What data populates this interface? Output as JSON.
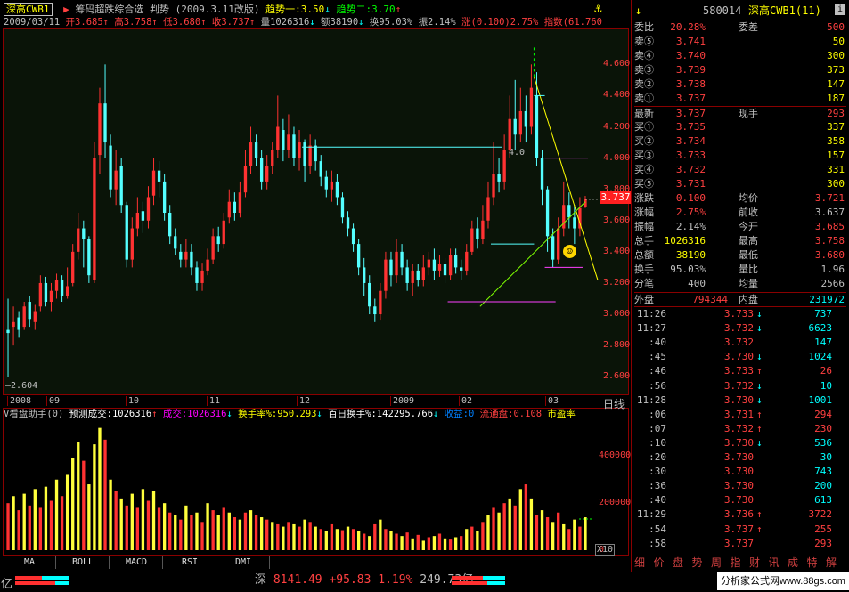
{
  "header": {
    "code_name": "深高CWB1",
    "indicator_name": "筹码超跌综合选",
    "mode": "判势",
    "date_tag": "(2009.3.11改版)",
    "trend1": "趋势一:3.50",
    "trend1_arrow": "↓",
    "trend2": "趋势二:3.70",
    "trend2_arrow": "↑",
    "icon_gear": "gear-icon",
    "row2": {
      "date": "2009/03/11",
      "open": "开3.685",
      "open_arrow": "↑",
      "high": "高3.758",
      "high_arrow": "↑",
      "low": "低3.680",
      "low_arrow": "↑",
      "close": "收3.737",
      "close_arrow": "↑",
      "volume": "量1026316",
      "volume_arrow": "↓",
      "amount": "额38190",
      "amount_arrow": "↓",
      "turnover": "换95.03%",
      "amplitude": "振2.14%",
      "change": "涨(0.100)2.75%",
      "index": "指数(61.760"
    }
  },
  "price_axis": {
    "ticks": [
      "4.600",
      "4.400",
      "4.200",
      "4.000",
      "3.800",
      "3.600",
      "3.400",
      "3.200",
      "3.000",
      "2.800",
      "2.600"
    ],
    "current_price_label": "3.737",
    "low_marker": "2.604",
    "inline_label_4": "4.0"
  },
  "time_axis": {
    "labels": [
      "2008",
      "09",
      "10",
      "11",
      "12",
      "2009",
      "02",
      "03"
    ],
    "period": "日线"
  },
  "volume_header": {
    "name": "V看盘助手(0)",
    "predicted": "预测成交:1026316",
    "predicted_arrow": "↑",
    "deal": "成交:1026316",
    "deal_arrow": "↓",
    "turnover_rate": "换手率%:950.293",
    "turnover_arrow": "↓",
    "hundred_day": "百日换手%:142295.766",
    "hundred_arrow": "↓",
    "earnings": "收益:0",
    "float_cap": "流通盘:0.108",
    "pe": "市盈率"
  },
  "volume_axis": {
    "ticks": [
      "400000",
      "200000",
      "0"
    ],
    "multiplier": "X10"
  },
  "bottom_tabs": [
    "MA",
    "BOLL",
    "MACD",
    "RSI",
    "DMI"
  ],
  "right_tabs": [
    "细",
    "价",
    "盘",
    "势",
    "周",
    "指",
    "财",
    "讯",
    "成",
    "特",
    "解"
  ],
  "ticker_bar": {
    "exchange": "深",
    "index_value": "8141.49",
    "change": "+95.83",
    "percent": "1.19%",
    "amount": "249.73亿",
    "left_unit": "亿",
    "watermark": "分析家公式网www.88gs.com"
  },
  "quote_panel": {
    "code": "580014",
    "name": "深高CWB1(11)",
    "commission_ratio_label": "委比",
    "commission_ratio": "20.28%",
    "commission_diff_label": "委差",
    "commission_diff": "500",
    "asks": [
      {
        "label": "卖⑤",
        "price": "3.741",
        "vol": "50"
      },
      {
        "label": "卖④",
        "price": "3.740",
        "vol": "300"
      },
      {
        "label": "卖③",
        "price": "3.739",
        "vol": "373"
      },
      {
        "label": "卖②",
        "price": "3.738",
        "vol": "147"
      },
      {
        "label": "卖①",
        "price": "3.737",
        "vol": "187"
      }
    ],
    "last_label": "最新",
    "last": "3.737",
    "hand_label": "现手",
    "hand": "293",
    "bids": [
      {
        "label": "买①",
        "price": "3.735",
        "vol": "337"
      },
      {
        "label": "买②",
        "price": "3.734",
        "vol": "358"
      },
      {
        "label": "买③",
        "price": "3.733",
        "vol": "157"
      },
      {
        "label": "买④",
        "price": "3.732",
        "vol": "331"
      },
      {
        "label": "买⑤",
        "price": "3.731",
        "vol": "300"
      }
    ],
    "stats": [
      {
        "l1": "涨跌",
        "v1": "0.100",
        "l2": "均价",
        "v2": "3.721",
        "c1": "#ff4040",
        "c2": "#ff4040"
      },
      {
        "l1": "涨幅",
        "v1": "2.75%",
        "l2": "前收",
        "v2": "3.637",
        "c1": "#ff4040",
        "c2": "#c0c0c0"
      },
      {
        "l1": "振幅",
        "v1": "2.14%",
        "l2": "今开",
        "v2": "3.685",
        "c1": "#c0c0c0",
        "c2": "#ff4040"
      },
      {
        "l1": "总手",
        "v1": "1026316",
        "l2": "最高",
        "v2": "3.758",
        "c1": "#ffff00",
        "c2": "#ff4040"
      },
      {
        "l1": "总额",
        "v1": "38190",
        "l2": "最低",
        "v2": "3.680",
        "c1": "#ffff00",
        "c2": "#ff4040"
      },
      {
        "l1": "换手",
        "v1": "95.03%",
        "l2": "量比",
        "v2": "1.96",
        "c1": "#c0c0c0",
        "c2": "#c0c0c0"
      },
      {
        "l1": "分笔",
        "v1": "400",
        "l2": "均量",
        "v2": "2566",
        "c1": "#c0c0c0",
        "c2": "#c0c0c0"
      }
    ],
    "outer_label": "外盘",
    "outer": "794344",
    "inner_label": "内盘",
    "inner": "231972",
    "trades": [
      {
        "t": "11:26",
        "p": "3.733",
        "a": "↓",
        "q": "737",
        "k": "",
        "c": "#ff4040",
        "ac": "#00ffff"
      },
      {
        "t": "11:27",
        "p": "3.732",
        "a": "↓",
        "q": "6623",
        "k": "",
        "c": "#ff4040",
        "ac": "#00ffff"
      },
      {
        "t": ":40",
        "p": "3.732",
        "a": "",
        "q": "147",
        "k": "",
        "c": "#ff4040",
        "ac": "#00ffff"
      },
      {
        "t": ":45",
        "p": "3.730",
        "a": "↓",
        "q": "1024",
        "k": "",
        "c": "#ff4040",
        "ac": "#00ffff"
      },
      {
        "t": ":46",
        "p": "3.733",
        "a": "↑",
        "q": "26",
        "k": "",
        "c": "#ff4040",
        "ac": "#ff4040"
      },
      {
        "t": ":56",
        "p": "3.732",
        "a": "↓",
        "q": "10",
        "k": "",
        "c": "#ff4040",
        "ac": "#00ffff"
      },
      {
        "t": "11:28",
        "p": "3.730",
        "a": "↓",
        "q": "1001",
        "k": "",
        "c": "#ff4040",
        "ac": "#00ffff"
      },
      {
        "t": ":06",
        "p": "3.731",
        "a": "↑",
        "q": "294",
        "k": "",
        "c": "#ff4040",
        "ac": "#ff4040"
      },
      {
        "t": ":07",
        "p": "3.732",
        "a": "↑",
        "q": "230",
        "k": "",
        "c": "#ff4040",
        "ac": "#ff4040"
      },
      {
        "t": ":10",
        "p": "3.730",
        "a": "↓",
        "q": "536",
        "k": "",
        "c": "#ff4040",
        "ac": "#00ffff"
      },
      {
        "t": ":20",
        "p": "3.730",
        "a": "",
        "q": "30",
        "k": "",
        "c": "#ff4040",
        "ac": "#00ffff"
      },
      {
        "t": ":30",
        "p": "3.730",
        "a": "",
        "q": "743",
        "k": "",
        "c": "#ff4040",
        "ac": "#00ffff"
      },
      {
        "t": ":36",
        "p": "3.730",
        "a": "",
        "q": "200",
        "k": "",
        "c": "#ff4040",
        "ac": "#00ffff"
      },
      {
        "t": ":40",
        "p": "3.730",
        "a": "",
        "q": "613",
        "k": "",
        "c": "#ff4040",
        "ac": "#00ffff"
      },
      {
        "t": "11:29",
        "p": "3.736",
        "a": "↑",
        "q": "3722",
        "k": "",
        "c": "#ff4040",
        "ac": "#ff4040"
      },
      {
        "t": ":54",
        "p": "3.737",
        "a": "↑",
        "q": "255",
        "k": "",
        "c": "#ff4040",
        "ac": "#ff4040"
      },
      {
        "t": ":58",
        "p": "3.737",
        "a": "",
        "q": "293",
        "k": "",
        "c": "#ff4040",
        "ac": "#ff4040"
      }
    ]
  },
  "colors": {
    "up": "#ff3232",
    "down": "#54ffff",
    "vol_up": "#ff3232",
    "vol_alt": "#ffff3c",
    "axis": "#ff4040",
    "pane_border": "#8a0000"
  },
  "chart_data": {
    "type": "candlestick",
    "price_ylim": [
      2.55,
      4.75
    ],
    "volume_ylim": [
      0,
      530000
    ],
    "candles": [
      [
        2.9,
        2.88,
        3.1,
        2.6
      ],
      [
        2.92,
        2.95,
        3.05,
        2.8
      ],
      [
        2.98,
        2.9,
        3.02,
        2.85
      ],
      [
        2.92,
        3.05,
        3.08,
        2.9
      ],
      [
        3.08,
        2.97,
        3.12,
        2.92
      ],
      [
        2.95,
        3.02,
        3.06,
        2.9
      ],
      [
        3.05,
        3.2,
        3.25,
        3.02
      ],
      [
        3.2,
        3.08,
        3.24,
        3.05
      ],
      [
        3.08,
        3.15,
        3.2,
        3.02
      ],
      [
        3.15,
        3.22,
        3.26,
        3.1
      ],
      [
        3.22,
        3.12,
        3.25,
        3.08
      ],
      [
        3.12,
        3.18,
        3.3,
        3.1
      ],
      [
        3.2,
        3.4,
        3.45,
        3.18
      ],
      [
        3.4,
        3.55,
        3.65,
        3.35
      ],
      [
        3.55,
        3.48,
        3.6,
        3.3
      ],
      [
        3.48,
        3.25,
        3.5,
        3.2
      ],
      [
        3.22,
        4.0,
        4.1,
        3.2
      ],
      [
        4.02,
        4.35,
        4.45,
        3.9
      ],
      [
        4.35,
        4.1,
        4.6,
        4.0
      ],
      [
        4.08,
        3.8,
        4.15,
        3.75
      ],
      [
        3.8,
        3.92,
        4.05,
        3.7
      ],
      [
        3.95,
        3.7,
        4.0,
        3.65
      ],
      [
        3.7,
        3.35,
        3.72,
        3.3
      ],
      [
        3.35,
        3.55,
        3.62,
        3.3
      ],
      [
        3.55,
        3.65,
        3.75,
        3.5
      ],
      [
        3.66,
        3.6,
        3.72,
        3.52
      ],
      [
        3.6,
        3.75,
        3.82,
        3.55
      ],
      [
        3.76,
        3.92,
        4.0,
        3.7
      ],
      [
        3.92,
        3.85,
        3.98,
        3.75
      ],
      [
        3.85,
        3.65,
        3.9,
        3.6
      ],
      [
        3.65,
        3.5,
        3.7,
        3.45
      ],
      [
        3.5,
        3.42,
        3.55,
        3.38
      ],
      [
        3.4,
        3.35,
        3.45,
        3.3
      ],
      [
        3.35,
        3.4,
        3.48,
        3.3
      ],
      [
        3.4,
        3.3,
        3.45,
        3.25
      ],
      [
        3.3,
        3.2,
        3.34,
        3.15
      ],
      [
        3.2,
        3.28,
        3.33,
        3.15
      ],
      [
        3.28,
        3.35,
        3.42,
        3.25
      ],
      [
        3.35,
        3.5,
        3.55,
        3.32
      ],
      [
        3.5,
        3.45,
        3.56,
        3.4
      ],
      [
        3.45,
        3.6,
        3.65,
        3.42
      ],
      [
        3.62,
        3.72,
        3.8,
        3.58
      ],
      [
        3.72,
        3.65,
        3.78,
        3.6
      ],
      [
        3.65,
        3.78,
        3.85,
        3.62
      ],
      [
        3.78,
        3.95,
        4.05,
        3.75
      ],
      [
        3.95,
        4.1,
        4.2,
        3.9
      ],
      [
        4.1,
        4.0,
        4.15,
        3.95
      ],
      [
        4.0,
        3.85,
        4.05,
        3.8
      ],
      [
        3.85,
        3.95,
        4.02,
        3.8
      ],
      [
        3.95,
        4.05,
        4.1,
        3.9
      ],
      [
        4.05,
        4.2,
        4.4,
        4.0
      ],
      [
        4.18,
        4.05,
        4.25,
        3.98
      ],
      [
        4.05,
        4.15,
        4.28,
        4.0
      ],
      [
        4.15,
        4.0,
        4.2,
        3.95
      ],
      [
        4.0,
        4.1,
        4.18,
        3.92
      ],
      [
        4.1,
        3.95,
        4.12,
        3.85
      ],
      [
        3.95,
        4.08,
        4.15,
        3.9
      ],
      [
        4.08,
        3.98,
        4.12,
        3.92
      ],
      [
        3.98,
        3.88,
        4.02,
        3.82
      ],
      [
        3.88,
        3.8,
        3.92,
        3.75
      ],
      [
        3.8,
        3.85,
        3.92,
        3.72
      ],
      [
        3.85,
        3.75,
        3.9,
        3.7
      ],
      [
        3.75,
        3.62,
        3.78,
        3.58
      ],
      [
        3.62,
        3.55,
        3.66,
        3.5
      ],
      [
        3.55,
        3.45,
        3.58,
        3.4
      ],
      [
        3.45,
        3.3,
        3.48,
        3.25
      ],
      [
        3.3,
        3.2,
        3.36,
        3.12
      ],
      [
        3.2,
        3.05,
        3.25,
        3.0
      ],
      [
        3.05,
        3.0,
        3.1,
        2.95
      ],
      [
        3.0,
        3.15,
        3.2,
        2.96
      ],
      [
        3.15,
        3.35,
        3.4,
        3.1
      ],
      [
        3.35,
        3.25,
        3.4,
        3.18
      ],
      [
        3.25,
        3.4,
        3.48,
        3.2
      ],
      [
        3.4,
        3.3,
        3.45,
        3.25
      ],
      [
        3.3,
        3.2,
        3.35,
        3.15
      ],
      [
        3.2,
        3.28,
        3.32,
        3.12
      ],
      [
        3.28,
        3.22,
        3.32,
        3.18
      ],
      [
        3.22,
        3.3,
        3.38,
        3.18
      ],
      [
        3.3,
        3.35,
        3.4,
        3.25
      ],
      [
        3.35,
        3.28,
        3.42,
        3.22
      ],
      [
        3.28,
        3.32,
        3.38,
        3.24
      ],
      [
        3.32,
        3.25,
        3.36,
        3.2
      ],
      [
        3.25,
        3.38,
        3.42,
        3.22
      ],
      [
        3.38,
        3.3,
        3.42,
        3.26
      ],
      [
        3.3,
        3.28,
        3.35,
        3.22
      ],
      [
        3.28,
        3.4,
        3.45,
        3.25
      ],
      [
        3.4,
        3.55,
        3.6,
        3.38
      ],
      [
        3.55,
        3.48,
        3.62,
        3.42
      ],
      [
        3.48,
        3.6,
        3.7,
        3.45
      ],
      [
        3.6,
        3.75,
        3.85,
        3.55
      ],
      [
        3.75,
        3.9,
        4.1,
        3.7
      ],
      [
        3.9,
        3.85,
        4.0,
        3.78
      ],
      [
        3.85,
        4.05,
        4.15,
        3.8
      ],
      [
        4.05,
        4.25,
        4.4,
        4.0
      ],
      [
        4.25,
        4.15,
        4.5,
        4.05
      ],
      [
        4.15,
        4.3,
        4.45,
        4.1
      ],
      [
        4.3,
        4.2,
        4.4,
        4.1
      ],
      [
        4.2,
        4.45,
        4.6,
        4.15
      ],
      [
        4.4,
        4.0,
        4.55,
        3.95
      ],
      [
        4.0,
        3.8,
        4.05,
        3.7
      ],
      [
        3.8,
        3.5,
        3.82,
        3.4
      ],
      [
        3.5,
        3.35,
        3.55,
        3.3
      ],
      [
        3.35,
        3.55,
        3.62,
        3.32
      ],
      [
        3.55,
        3.7,
        3.85,
        3.5
      ],
      [
        3.7,
        3.62,
        3.78,
        3.55
      ],
      [
        3.62,
        3.55,
        3.7,
        3.45
      ],
      [
        3.55,
        3.68,
        3.75,
        3.5
      ],
      [
        3.685,
        3.737,
        3.758,
        3.68
      ]
    ],
    "volume": [
      [
        200000,
        0
      ],
      [
        230000,
        1
      ],
      [
        170000,
        0
      ],
      [
        240000,
        1
      ],
      [
        190000,
        0
      ],
      [
        260000,
        1
      ],
      [
        180000,
        0
      ],
      [
        270000,
        1
      ],
      [
        210000,
        0
      ],
      [
        300000,
        1
      ],
      [
        230000,
        0
      ],
      [
        320000,
        1
      ],
      [
        390000,
        1
      ],
      [
        460000,
        1
      ],
      [
        380000,
        0
      ],
      [
        280000,
        1
      ],
      [
        450000,
        1
      ],
      [
        520000,
        1
      ],
      [
        470000,
        0
      ],
      [
        300000,
        1
      ],
      [
        250000,
        0
      ],
      [
        220000,
        1
      ],
      [
        190000,
        0
      ],
      [
        240000,
        1
      ],
      [
        180000,
        0
      ],
      [
        260000,
        1
      ],
      [
        210000,
        0
      ],
      [
        250000,
        1
      ],
      [
        180000,
        0
      ],
      [
        200000,
        1
      ],
      [
        160000,
        0
      ],
      [
        150000,
        1
      ],
      [
        130000,
        0
      ],
      [
        190000,
        1
      ],
      [
        150000,
        0
      ],
      [
        160000,
        1
      ],
      [
        120000,
        0
      ],
      [
        200000,
        1
      ],
      [
        170000,
        0
      ],
      [
        150000,
        1
      ],
      [
        180000,
        0
      ],
      [
        160000,
        1
      ],
      [
        140000,
        0
      ],
      [
        130000,
        1
      ],
      [
        160000,
        0
      ],
      [
        170000,
        1
      ],
      [
        150000,
        0
      ],
      [
        140000,
        1
      ],
      [
        130000,
        0
      ],
      [
        120000,
        1
      ],
      [
        110000,
        0
      ],
      [
        100000,
        1
      ],
      [
        120000,
        0
      ],
      [
        110000,
        1
      ],
      [
        100000,
        0
      ],
      [
        130000,
        1
      ],
      [
        120000,
        0
      ],
      [
        100000,
        1
      ],
      [
        90000,
        0
      ],
      [
        80000,
        1
      ],
      [
        110000,
        0
      ],
      [
        90000,
        1
      ],
      [
        85000,
        0
      ],
      [
        100000,
        1
      ],
      [
        90000,
        0
      ],
      [
        80000,
        1
      ],
      [
        70000,
        0
      ],
      [
        60000,
        1
      ],
      [
        110000,
        0
      ],
      [
        130000,
        1
      ],
      [
        90000,
        0
      ],
      [
        80000,
        1
      ],
      [
        70000,
        0
      ],
      [
        60000,
        1
      ],
      [
        75000,
        0
      ],
      [
        50000,
        1
      ],
      [
        65000,
        0
      ],
      [
        40000,
        1
      ],
      [
        55000,
        0
      ],
      [
        60000,
        1
      ],
      [
        70000,
        0
      ],
      [
        50000,
        1
      ],
      [
        45000,
        0
      ],
      [
        55000,
        1
      ],
      [
        60000,
        0
      ],
      [
        90000,
        1
      ],
      [
        100000,
        0
      ],
      [
        80000,
        1
      ],
      [
        120000,
        0
      ],
      [
        150000,
        1
      ],
      [
        180000,
        0
      ],
      [
        160000,
        1
      ],
      [
        200000,
        0
      ],
      [
        220000,
        1
      ],
      [
        190000,
        0
      ],
      [
        260000,
        1
      ],
      [
        280000,
        0
      ],
      [
        220000,
        1
      ],
      [
        150000,
        0
      ],
      [
        170000,
        1
      ],
      [
        140000,
        0
      ],
      [
        120000,
        1
      ],
      [
        160000,
        0
      ],
      [
        110000,
        1
      ],
      [
        90000,
        0
      ],
      [
        130000,
        1
      ],
      [
        100000,
        0
      ],
      [
        140000,
        1
      ]
    ]
  }
}
